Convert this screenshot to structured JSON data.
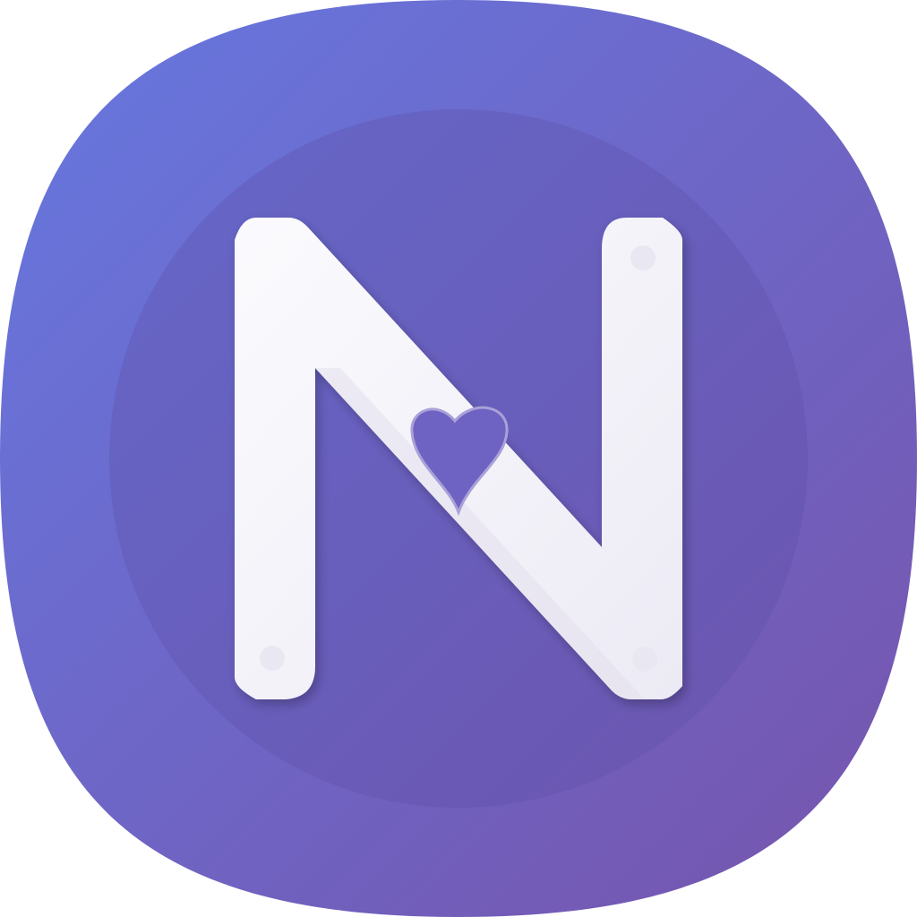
{
  "app_icon": {
    "logo_letter": "N",
    "shape": "squircle",
    "colors": {
      "background_start": "#6678E0",
      "background_end": "#7654AC",
      "inner_circle": "#5E4FA8",
      "letter": "#F6F5FB",
      "letter_shade": "#ECEAF4",
      "heart_fill": "#6E62C2",
      "heart_outline": "#A9A1D8",
      "rivet": "#E9E7F1"
    },
    "icons": [
      "letter-n-icon",
      "heart-icon",
      "rivet-icon"
    ]
  }
}
